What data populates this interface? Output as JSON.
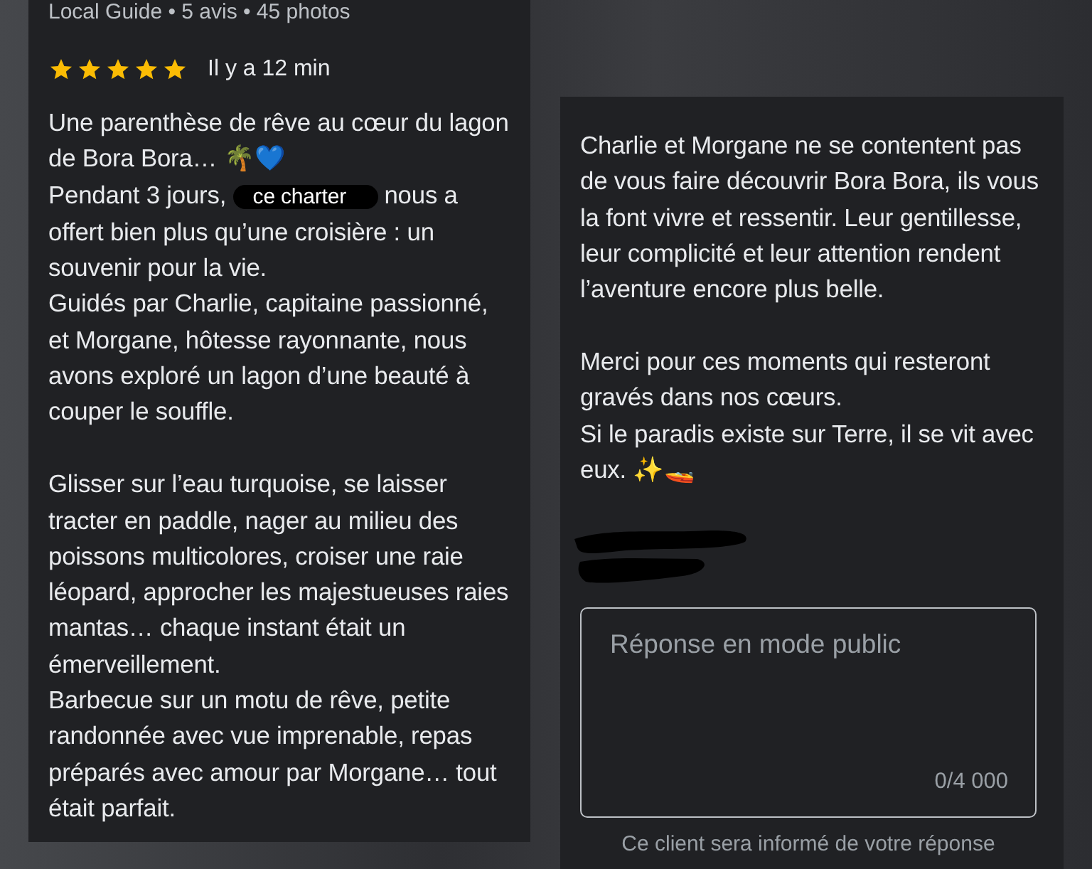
{
  "left_review": {
    "reviewer_meta": "Local Guide • 5 avis • 45 photos",
    "stars": 5,
    "time": "Il y a 12 min",
    "body": [
      {
        "kind": "text",
        "text": "Une parenthèse de rêve au cœur du lagon de Bora Bora… 🌴💙"
      },
      {
        "kind": "redacted",
        "before": "Pendant 3 jours,",
        "redacted": "ce charter",
        "after": "nous a offert bien plus qu’une croisière : un souvenir pour la vie."
      },
      {
        "kind": "text",
        "text": "Guidés par Charlie, capitaine passionné, et Morgane, hôtesse rayonnante, nous avons exploré un lagon d’une beauté à couper le souffle."
      },
      {
        "kind": "blank"
      },
      {
        "kind": "text",
        "text": "Glisser sur l’eau turquoise, se laisser tracter en paddle, nager au milieu des poissons multicolores, croiser une raie léopard, approcher les majestueuses raies mantas… chaque instant était un émerveillement."
      },
      {
        "kind": "text",
        "text": "Barbecue sur un motu de rêve, petite randonnée avec vue imprenable, repas préparés avec amour par Morgane… tout était parfait."
      }
    ]
  },
  "right_review": {
    "body": [
      {
        "kind": "text",
        "text": "Charlie et Morgane ne se contentent pas de vous faire découvrir Bora Bora, ils vous la font vivre et ressentir. Leur gentillesse, leur complicité et leur attention rendent l’aventure encore plus belle."
      },
      {
        "kind": "blank"
      },
      {
        "kind": "text",
        "text": "Merci pour ces moments qui resteront gravés dans nos cœurs."
      },
      {
        "kind": "text",
        "text": "Si le paradis existe sur Terre, il se vit avec eux. ✨🚤"
      },
      {
        "kind": "signature"
      }
    ],
    "reply_field": {
      "placeholder": "Réponse en mode public",
      "counter": "0/4 000"
    },
    "notice": "Ce client sera informé de votre réponse"
  }
}
